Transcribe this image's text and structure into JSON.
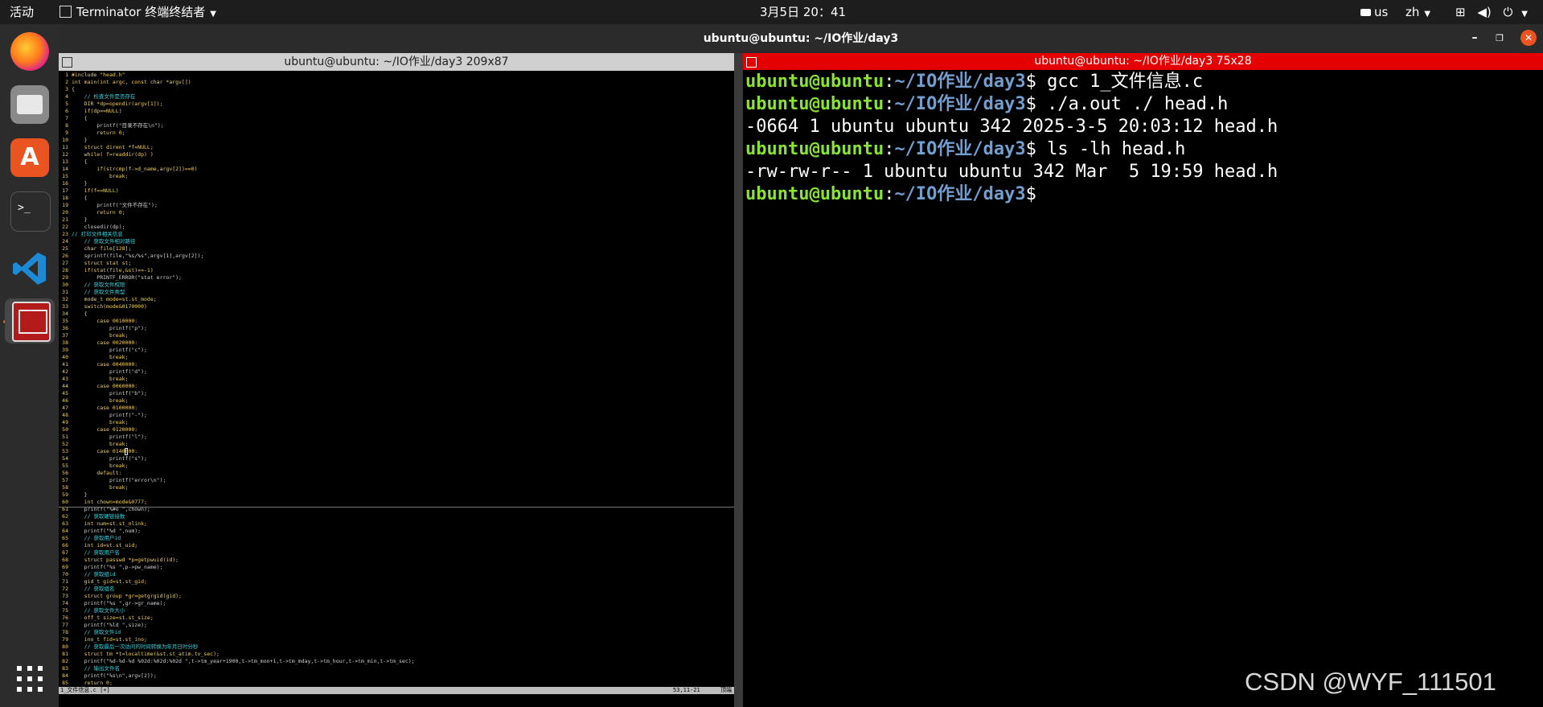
{
  "topbar": {
    "activities": "活动",
    "app_name": "Terminator 终端终结者",
    "clock": "3月5日 20：41",
    "keyboard_layout": "us",
    "input_method": "zh"
  },
  "window": {
    "title": "ubuntu@ubuntu: ~/IO作业/day3"
  },
  "left_terminal": {
    "title": "ubuntu@ubuntu: ~/IO作业/day3 209x87",
    "status_left": "1_文件信息.c [+]",
    "status_right": "53,11-21",
    "status_end": "顶端",
    "code_lines": [
      {
        "n": "1",
        "t": "#include \"head.h\""
      },
      {
        "n": "2",
        "t": "int main(int argc, const char *argv[])"
      },
      {
        "n": "3",
        "t": "{"
      },
      {
        "n": "4",
        "t": "    // 检查文件是否存在"
      },
      {
        "n": "5",
        "t": "    DIR *dp=opendir(argv[1]);"
      },
      {
        "n": "6",
        "t": "    if(dp==NULL)"
      },
      {
        "n": "7",
        "t": "    {"
      },
      {
        "n": "8",
        "t": "        printf(\"目录不存在\\n\");"
      },
      {
        "n": "9",
        "t": "        return 0;"
      },
      {
        "n": "10",
        "t": "    }"
      },
      {
        "n": "11",
        "t": "    struct dirent *f=NULL;"
      },
      {
        "n": "12",
        "t": "    while( f=readdir(dp) )"
      },
      {
        "n": "13",
        "t": "    {"
      },
      {
        "n": "14",
        "t": "        if(strcmp(f->d_name,argv[2])==0)"
      },
      {
        "n": "15",
        "t": "            break;"
      },
      {
        "n": "16",
        "t": "    }"
      },
      {
        "n": "17",
        "t": "    if(f==NULL)"
      },
      {
        "n": "18",
        "t": "    {"
      },
      {
        "n": "19",
        "t": "        printf(\"文件不存在\");"
      },
      {
        "n": "20",
        "t": "        return 0;"
      },
      {
        "n": "21",
        "t": "    }"
      },
      {
        "n": "22",
        "t": "    closedir(dp);"
      },
      {
        "n": "23",
        "t": "// 打印文件相关信息"
      },
      {
        "n": "24",
        "t": "    // 获取文件相对路径"
      },
      {
        "n": "25",
        "t": "    char file[128];"
      },
      {
        "n": "26",
        "t": "    sprintf(file,\"%s/%s\",argv[1],argv[2]);"
      },
      {
        "n": "27",
        "t": "    struct stat st;"
      },
      {
        "n": "28",
        "t": "    if(stat(file,&st)==-1)"
      },
      {
        "n": "29",
        "t": "        PRINTF_ERROR(\"stat error\");"
      },
      {
        "n": "30",
        "t": "    // 获取文件权限"
      },
      {
        "n": "31",
        "t": "    // 获取文件类型"
      },
      {
        "n": "32",
        "t": "    mode_t mode=st.st_mode;"
      },
      {
        "n": "33",
        "t": "    switch(mode&0170000)"
      },
      {
        "n": "34",
        "t": "    {"
      },
      {
        "n": "35",
        "t": "        case 0010000:"
      },
      {
        "n": "36",
        "t": "            printf(\"p\");"
      },
      {
        "n": "37",
        "t": "            break;"
      },
      {
        "n": "38",
        "t": "        case 0020000:"
      },
      {
        "n": "39",
        "t": "            printf(\"c\");"
      },
      {
        "n": "40",
        "t": "            break;"
      },
      {
        "n": "41",
        "t": "        case 0040000:"
      },
      {
        "n": "42",
        "t": "            printf(\"d\");"
      },
      {
        "n": "43",
        "t": "            break;"
      },
      {
        "n": "44",
        "t": "        case 0060000:"
      },
      {
        "n": "45",
        "t": "            printf(\"b\");"
      },
      {
        "n": "46",
        "t": "            break;"
      },
      {
        "n": "47",
        "t": "        case 0100000:"
      },
      {
        "n": "48",
        "t": "            printf(\"-\");"
      },
      {
        "n": "49",
        "t": "            break;"
      },
      {
        "n": "50",
        "t": "        case 0120000:"
      },
      {
        "n": "51",
        "t": "            printf(\"l\");"
      },
      {
        "n": "52",
        "t": "            break;"
      },
      {
        "n": "53",
        "t": "        case 0140000:"
      },
      {
        "n": "54",
        "t": "            printf(\"s\");"
      },
      {
        "n": "55",
        "t": "            break;"
      },
      {
        "n": "56",
        "t": "        default:"
      },
      {
        "n": "57",
        "t": "            printf(\"error\\n\");"
      },
      {
        "n": "58",
        "t": "            break;"
      },
      {
        "n": "59",
        "t": "    }"
      },
      {
        "n": "60",
        "t": "    int chown=mode&0777;"
      },
      {
        "n": "61",
        "t": "    printf(\"%#o \",chown);"
      },
      {
        "n": "62",
        "t": "    // 获取硬链接数"
      },
      {
        "n": "63",
        "t": "    int num=st.st_nlink;"
      },
      {
        "n": "64",
        "t": "    printf(\"%d \",num);"
      },
      {
        "n": "65",
        "t": "    // 获取用户id"
      },
      {
        "n": "66",
        "t": "    int id=st.st_uid;"
      },
      {
        "n": "67",
        "t": "    // 获取用户名"
      },
      {
        "n": "68",
        "t": "    struct passwd *p=getpwuid(id);"
      },
      {
        "n": "69",
        "t": "    printf(\"%s \",p->pw_name);"
      },
      {
        "n": "70",
        "t": "    // 获取组id"
      },
      {
        "n": "71",
        "t": "    gid_t gid=st.st_gid;"
      },
      {
        "n": "72",
        "t": "    // 获取组名"
      },
      {
        "n": "73",
        "t": "    struct group *gr=getgrgid(gid);"
      },
      {
        "n": "74",
        "t": "    printf(\"%s \",gr->gr_name);"
      },
      {
        "n": "75",
        "t": "    // 获取文件大小"
      },
      {
        "n": "76",
        "t": "    off_t size=st.st_size;"
      },
      {
        "n": "77",
        "t": "    printf(\"%ld \",size);"
      },
      {
        "n": "78",
        "t": "    // 获取文件id"
      },
      {
        "n": "79",
        "t": "    ino_t fid=st.st_ino;"
      },
      {
        "n": "80",
        "t": "    // 获取最后一次访问的时间转换为年月日时分秒"
      },
      {
        "n": "81",
        "t": "    struct tm *t=localtime(&st.st_atim.tv_sec);"
      },
      {
        "n": "82",
        "t": "    printf(\"%d-%d-%d %02d:%02d:%02d \",t->tm_year+1900,t->tm_mon+1,t->tm_mday,t->tm_hour,t->tm_min,t->tm_sec);"
      },
      {
        "n": "83",
        "t": "    // 输出文件名"
      },
      {
        "n": "84",
        "t": "    printf(\"%s\\n\",argv[2]);"
      },
      {
        "n": "85",
        "t": "    return 0;"
      }
    ]
  },
  "right_terminal": {
    "title": "ubuntu@ubuntu: ~/IO作业/day3 75x28",
    "prompt_user": "ubuntu@ubuntu",
    "prompt_sep": ":",
    "prompt_path": "~/IO作业/day3",
    "prompt_end": "$ ",
    "lines": [
      {
        "type": "cmd",
        "text": "gcc 1_文件信息.c"
      },
      {
        "type": "cmd",
        "text": "./a.out ./ head.h"
      },
      {
        "type": "out",
        "text": "-0664 1 ubuntu ubuntu 342 2025-3-5 20:03:12 head.h"
      },
      {
        "type": "cmd",
        "text": "ls -lh head.h"
      },
      {
        "type": "out",
        "text": "-rw-rw-r-- 1 ubuntu ubuntu 342 Mar  5 19:59 head.h"
      },
      {
        "type": "cmd",
        "text": ""
      }
    ]
  },
  "watermark": "CSDN @WYF_111501",
  "dock_items": [
    "firefox-icon",
    "files-icon",
    "software-center-icon",
    "terminal-icon",
    "vscode-icon",
    "terminator-icon"
  ],
  "colors": {
    "accent_red": "#e40000",
    "prompt_green": "#8ae234",
    "prompt_blue": "#729fcf",
    "ubuntu_orange": "#e95420"
  }
}
